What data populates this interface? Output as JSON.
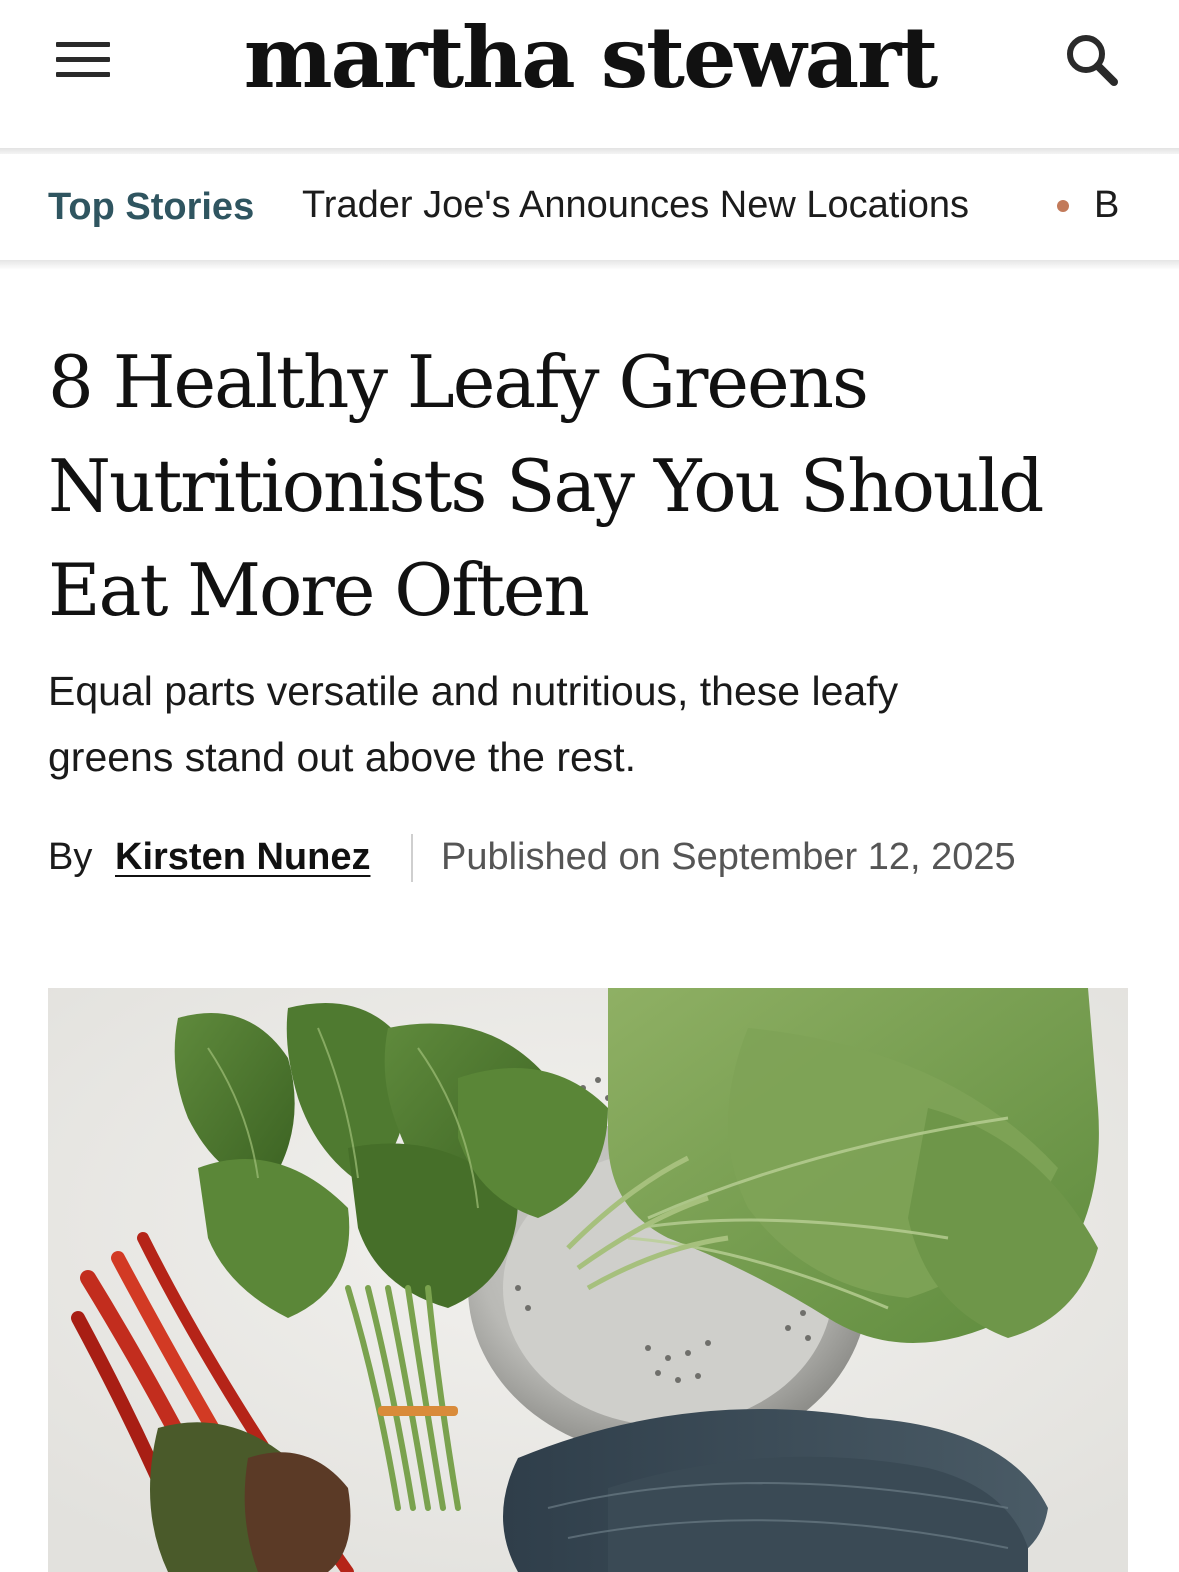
{
  "header": {
    "logo_text": "martha stewart",
    "menu_icon": "hamburger-menu-icon",
    "search_icon": "search-icon"
  },
  "ticker": {
    "label": "Top Stories",
    "items": [
      "Trader Joe's Announces New Locations",
      "B"
    ]
  },
  "article": {
    "headline_lines": [
      "8 Healthy Leafy Greens",
      "Nutritionists Say You Should",
      "Eat More Often"
    ],
    "dek_lines": [
      "Equal parts versatile and nutritious, these leafy",
      "greens stand out above the rest."
    ],
    "byline": {
      "prefix": "By",
      "author": "Kirsten Nunez",
      "published": "Published on September 12, 2025"
    }
  },
  "colors": {
    "ticker_label": "#2f5560",
    "ticker_dot": "#c27a5a",
    "text": "#111111",
    "muted": "#555555"
  }
}
